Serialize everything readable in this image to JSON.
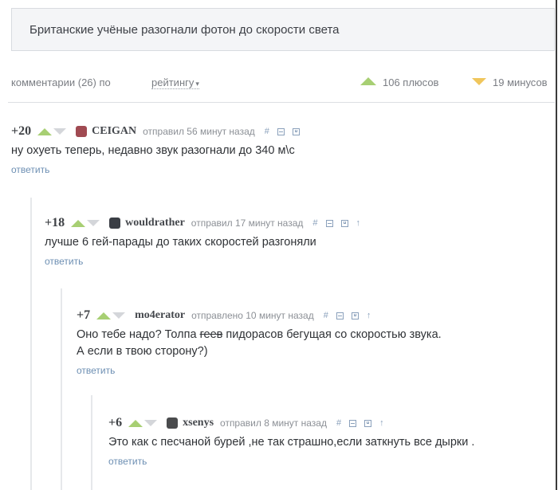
{
  "post": {
    "title": "Британские учёные разогнали фотон до скорости света"
  },
  "header": {
    "comments_prefix": "комментарии (26) по",
    "sort_label": "рейтингу",
    "sort_caret": "▾",
    "pluses": "106 плюсов",
    "minuses": "19 минусов"
  },
  "comments": [
    {
      "rating": "+20",
      "author": "CEIGAN",
      "posted": "отправил 56 минут назад",
      "hash": "#",
      "text": "ну охуеть теперь, недавно звук разогнали до 340 м\\с",
      "reply": "ответить",
      "avatar_color": "#a04a52"
    },
    {
      "rating": "+18",
      "author": "wouldrather",
      "posted": "отправил 17 минут назад",
      "hash": "#",
      "parent_arrow": "↑",
      "text": "лучше 6 гей-парады до таких скоростей разгоняли",
      "reply": "ответить",
      "avatar_color": "#3a3e45"
    },
    {
      "rating": "+7",
      "author": "mo4erator",
      "posted": "отправлено 10 минут назад",
      "hash": "#",
      "parent_arrow": "↑",
      "text_before": "Оно тебе надо? Толпа ",
      "text_strike": "геев",
      "text_after": " пидорасов бегущая со скоростью звука.",
      "text_line2": "А если в твою сторону?)",
      "reply": "ответить"
    },
    {
      "rating": "+6",
      "author": "xsenys",
      "posted": "отправил 8 минут назад",
      "hash": "#",
      "parent_arrow": "↑",
      "text": "Это как с песчаной бурей ,не так страшно,если заткнуть все дырки .",
      "reply": "ответить",
      "avatar_color": "#4a4b4d"
    }
  ],
  "colors": {
    "plus": "#a7cf73",
    "minus": "#f0c65c",
    "link": "#6d8fb3"
  }
}
